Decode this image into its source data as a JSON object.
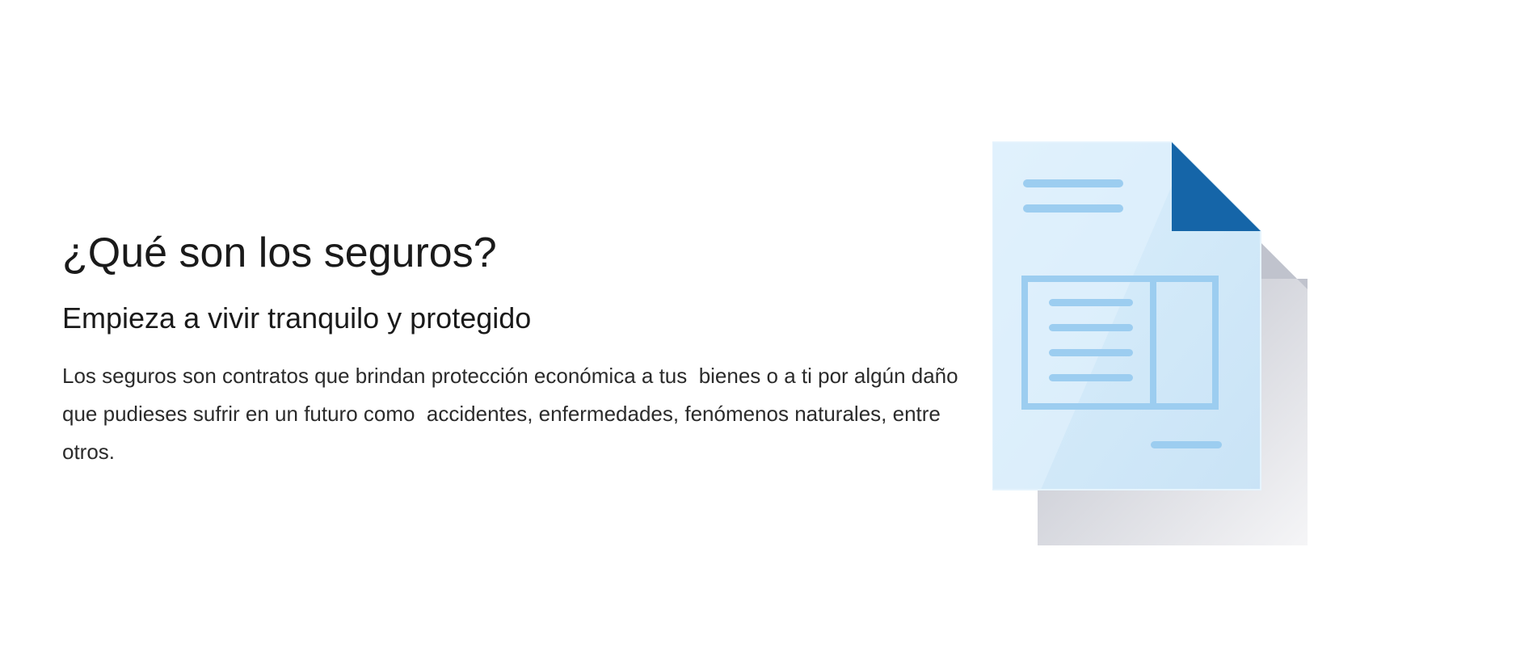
{
  "section": {
    "title": "¿Qué son los seguros?",
    "subtitle": "Empieza a vivir tranquilo y protegido",
    "description": "Los seguros son contratos que brindan protección económica a tus  bienes o a ti por algún daño que pudieses sufrir en un futuro como  accidentes, enfermedades, fenómenos naturales, entre otros."
  },
  "illustration": {
    "icon": "document-icon",
    "colors": {
      "page": "#d6ecfa",
      "fold": "#1565a8",
      "lines": "#9ccdf0",
      "shadow": "#c4c6cf"
    }
  }
}
